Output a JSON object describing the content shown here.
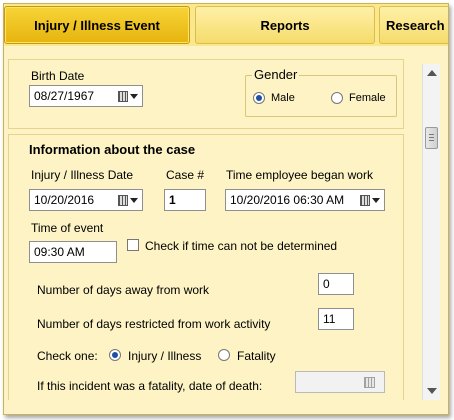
{
  "tabs": [
    {
      "label": "Injury / Illness Event",
      "active": true
    },
    {
      "label": "Reports",
      "active": false
    },
    {
      "label": "Research",
      "active": false
    }
  ],
  "birth": {
    "label": "Birth Date",
    "value": "08/27/1967"
  },
  "gender": {
    "legend": "Gender",
    "options": [
      "Male",
      "Female"
    ],
    "selected": "Male"
  },
  "case_section": {
    "title": "Information about the case",
    "injury_date_label": "Injury / Illness Date",
    "injury_date_value": "10/20/2016",
    "case_number_label": "Case #",
    "case_number_value": "1",
    "began_work_label": "Time employee began work",
    "began_work_value": "10/20/2016 06:30 AM",
    "time_event_label": "Time of event",
    "time_event_value": "09:30 AM",
    "time_undetermined_label": "Check if time can not be determined",
    "days_away_label": "Number of days away from work",
    "days_away_value": "0",
    "days_restricted_label": "Number of days restricted from work activity",
    "days_restricted_value": "11",
    "check_one_label": "Check one:",
    "type_options": [
      "Injury / Illness",
      "Fatality"
    ],
    "type_selected": "Injury / Illness",
    "fatality_date_label": "If this incident was a fatality, date of death:",
    "fatality_date_value": ""
  },
  "colors": {
    "background": "#fdf3c4",
    "tab_active": "#f2c623",
    "tab_inactive": "#f7e07a",
    "border": "#d9c677"
  },
  "icons": [
    "calendar-dropdown-icon",
    "scroll-up-arrow-icon",
    "scroll-down-arrow-icon"
  ]
}
